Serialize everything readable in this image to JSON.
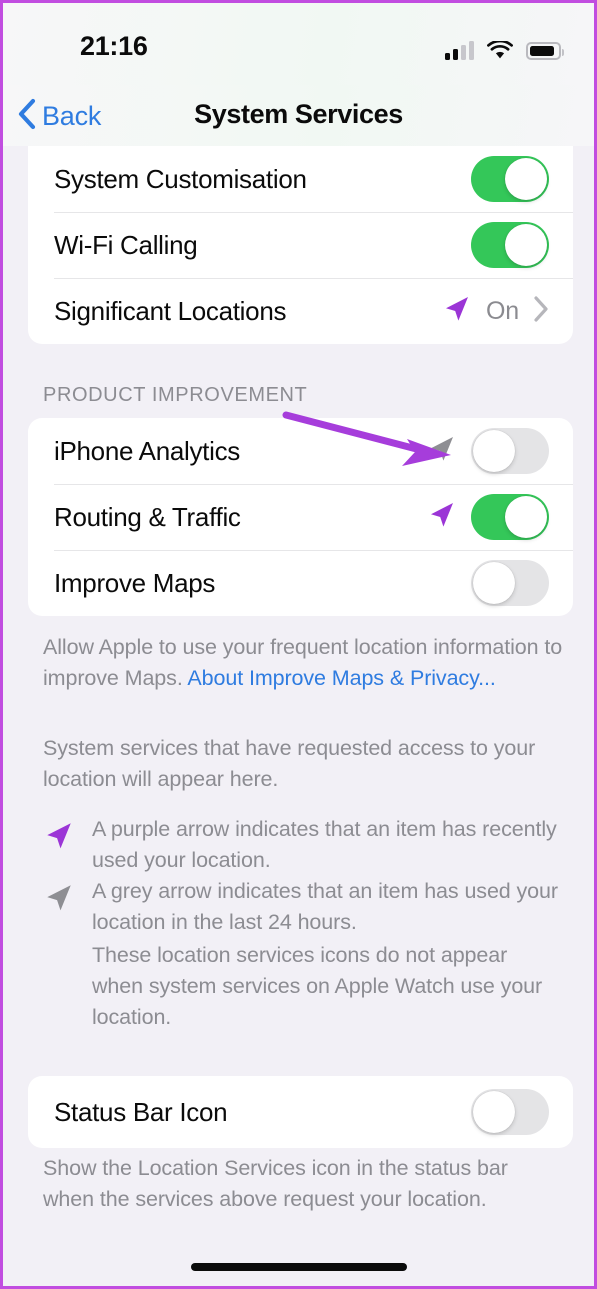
{
  "status_bar": {
    "time": "21:16",
    "cellular_icon": "cellular-signal-icon",
    "wifi_icon": "wifi-icon",
    "battery_icon": "battery-icon",
    "signal_bars_filled": 2,
    "signal_bars_total": 4,
    "battery_level_percent": 76
  },
  "nav": {
    "back_label": "Back",
    "back_icon": "chevron-left-icon",
    "title": "System Services"
  },
  "sections": {
    "top_list": {
      "rows": [
        {
          "label": "System Customisation",
          "control": "toggle",
          "on": true
        },
        {
          "label": "Wi-Fi Calling",
          "control": "toggle",
          "on": true
        },
        {
          "label": "Significant Locations",
          "control": "disclosure",
          "value": "On",
          "arrow": "purple"
        }
      ]
    },
    "product_improvement": {
      "header": "PRODUCT IMPROVEMENT",
      "rows": [
        {
          "label": "iPhone Analytics",
          "control": "toggle",
          "on": false,
          "arrow": "grey"
        },
        {
          "label": "Routing & Traffic",
          "control": "toggle",
          "on": true,
          "arrow": "purple"
        },
        {
          "label": "Improve Maps",
          "control": "toggle",
          "on": false,
          "arrow": "none"
        }
      ],
      "footnote_text": "Allow Apple to use your frequent location information to improve Maps. ",
      "footnote_link": "About Improve Maps & Privacy..."
    },
    "explainer": {
      "intro": "System services that have requested access to your location will appear here.",
      "legend": [
        {
          "arrow": "purple",
          "text": "A purple arrow indicates that an item has recently used your location."
        },
        {
          "arrow": "grey",
          "text": "A grey arrow indicates that an item has used your location in the last 24 hours."
        }
      ],
      "outro": "These location services icons do not appear when system services on Apple Watch use your location."
    },
    "status_bar_icon": {
      "rows": [
        {
          "label": "Status Bar Icon",
          "control": "toggle",
          "on": false
        }
      ],
      "footnote": "Show the Location Services icon in the status bar when the services above request your location."
    }
  },
  "annotation": {
    "type": "pointer-arrow",
    "color": "#a63ddb",
    "points_to": "iPhone Analytics toggle"
  },
  "colors": {
    "accent_blue": "#2f7ce0",
    "toggle_on_green": "#34c759",
    "toggle_off_grey": "#e4e4e6",
    "purple_arrow": "#9b35d6",
    "grey_arrow": "#8e8e93",
    "page_background": "#f2f0f6",
    "card_background": "#ffffff",
    "secondary_text": "#8c8c92",
    "frame_border": "#c14de0"
  },
  "home_indicator": "home-indicator"
}
